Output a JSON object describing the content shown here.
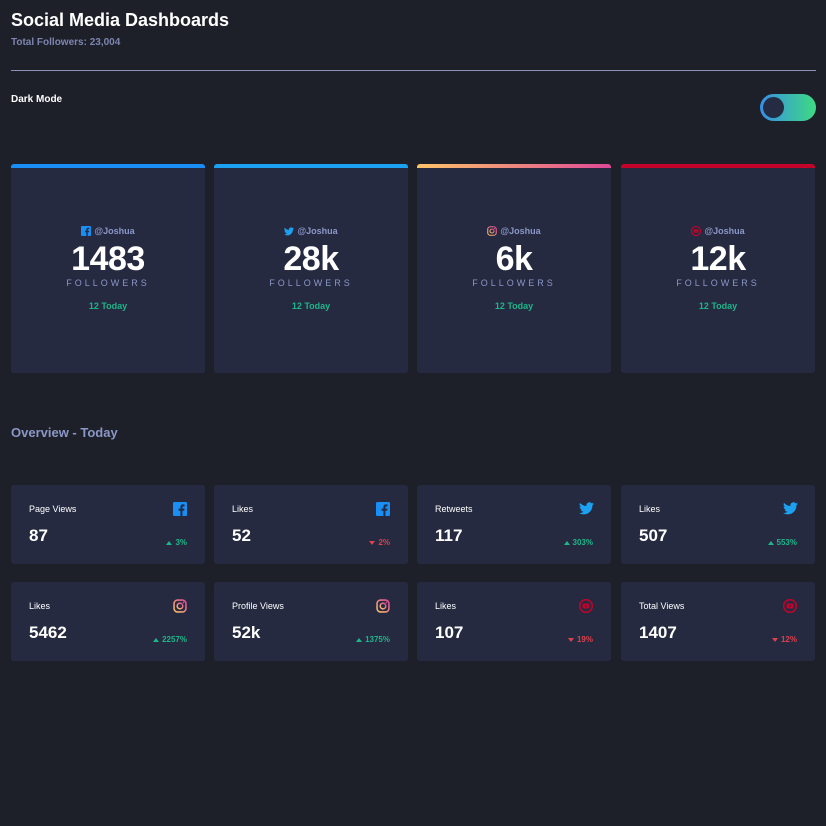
{
  "header": {
    "title": "Social Media Dashboards",
    "total_followers": "Total Followers: 23,004"
  },
  "dark_mode": {
    "label": "Dark Mode",
    "enabled": true
  },
  "colors": {
    "facebook": "#198ff5",
    "twitter": "#1ca0f2",
    "instagram_start": "#fdc468",
    "instagram_end": "#df4996",
    "youtube": "#c4032a",
    "up": "#1eb589",
    "down": "#dc414c"
  },
  "followers": [
    {
      "platform_icon": "facebook-icon",
      "handle": "@Joshua",
      "count": "1483",
      "label": "FOLLOWERS",
      "today": "12 Today"
    },
    {
      "platform_icon": "twitter-icon",
      "handle": "@Joshua",
      "count": "28k",
      "label": "FOLLOWERS",
      "today": "12 Today"
    },
    {
      "platform_icon": "instagram-icon",
      "handle": "@Joshua",
      "count": "6k",
      "label": "FOLLOWERS",
      "today": "12 Today"
    },
    {
      "platform_icon": "youtube-icon",
      "handle": "@Joshua",
      "count": "12k",
      "label": "FOLLOWERS",
      "today": "12 Today"
    }
  ],
  "overview": {
    "title": "Overview - Today",
    "items": [
      {
        "label": "Page Views",
        "value": "87",
        "change": "3%",
        "direction": "up",
        "icon": "facebook-icon"
      },
      {
        "label": "Likes",
        "value": "52",
        "change": "2%",
        "direction": "down",
        "icon": "facebook-icon"
      },
      {
        "label": "Retweets",
        "value": "117",
        "change": "303%",
        "direction": "up",
        "icon": "twitter-icon"
      },
      {
        "label": "Likes",
        "value": "507",
        "change": "553%",
        "direction": "up",
        "icon": "twitter-icon"
      },
      {
        "label": "Likes",
        "value": "5462",
        "change": "2257%",
        "direction": "up",
        "icon": "instagram-icon"
      },
      {
        "label": "Profile Views",
        "value": "52k",
        "change": "1375%",
        "direction": "up",
        "icon": "instagram-icon"
      },
      {
        "label": "Likes",
        "value": "107",
        "change": "19%",
        "direction": "down",
        "icon": "youtube-icon"
      },
      {
        "label": "Total Views",
        "value": "1407",
        "change": "12%",
        "direction": "down",
        "icon": "youtube-icon"
      }
    ]
  }
}
